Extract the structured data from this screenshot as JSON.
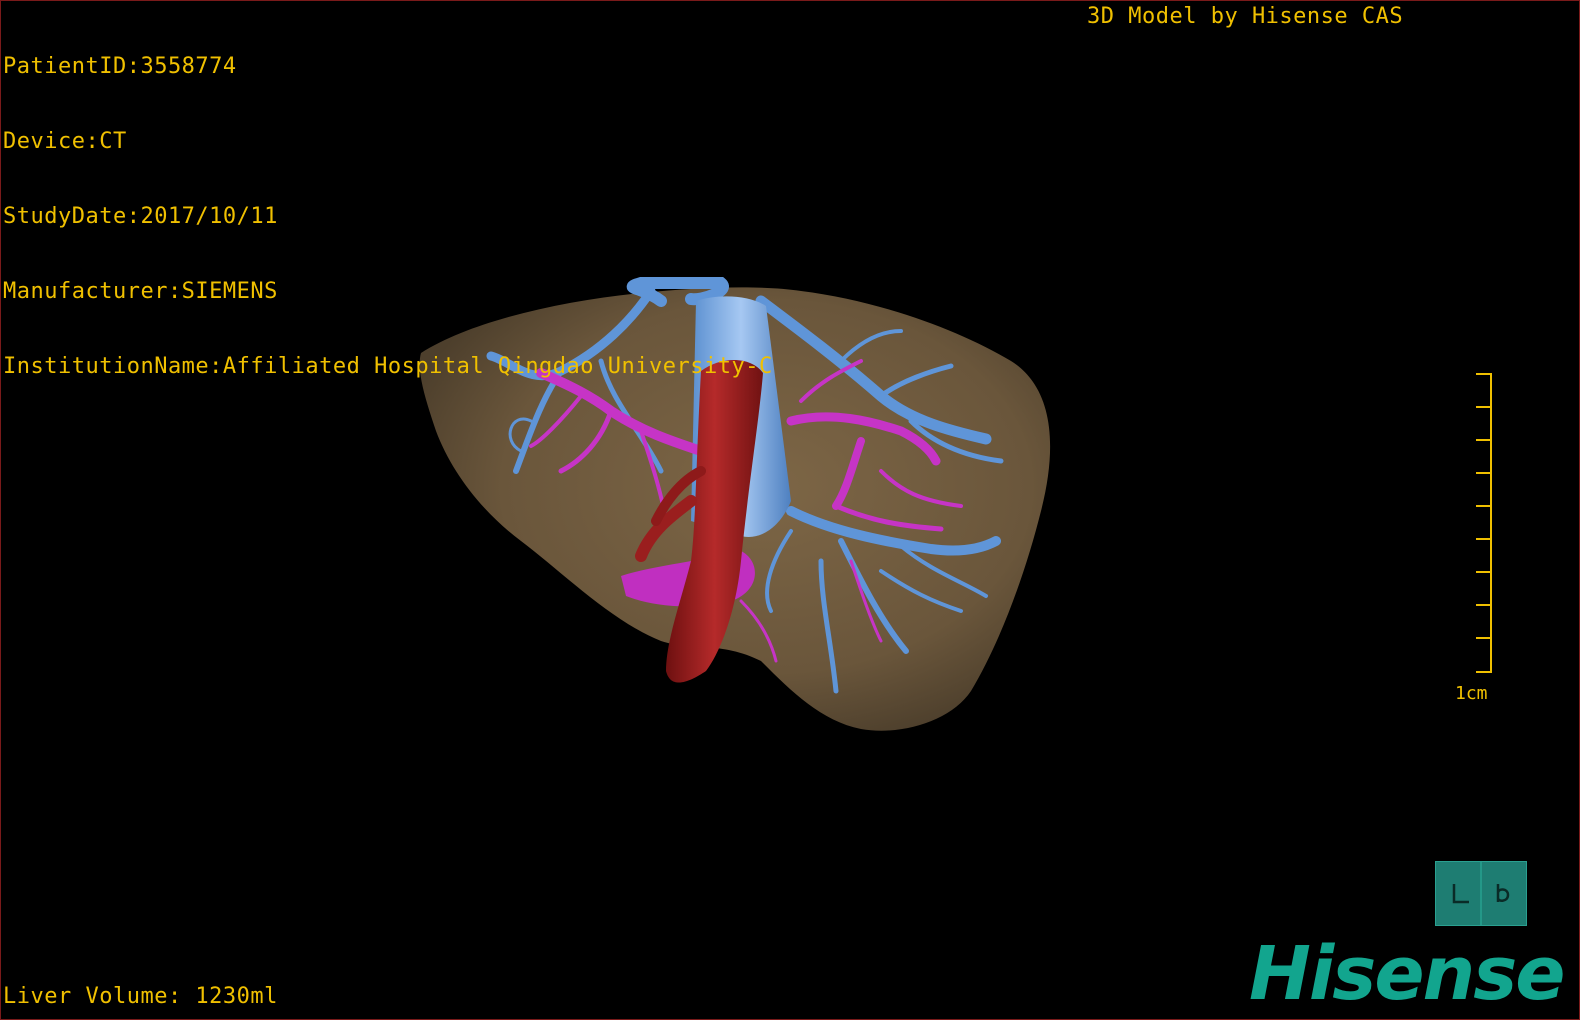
{
  "info": {
    "patient_id": "PatientID:3558774",
    "device": "Device:CT",
    "study_date": "StudyDate:2017/10/11",
    "manufacturer": "Manufacturer:SIEMENS",
    "institution": "InstitutionName:Affiliated Hospital Qingdao University-C"
  },
  "credit": "3D Model by Hisense CAS",
  "liver_volume": "Liver Volume: 1230ml",
  "scale": {
    "label": "1cm"
  },
  "orientation_cube": {
    "label": "L P"
  },
  "logo": {
    "text": "Hisense",
    "color": "#12a58e"
  },
  "colors": {
    "overlay_text": "#f0c000",
    "liver": "#6e5a3e",
    "hepatic_vein": "#5c92d6",
    "portal_vein": "#c433c4",
    "ivc_artery": "#9a1c1c",
    "background": "#000000"
  }
}
